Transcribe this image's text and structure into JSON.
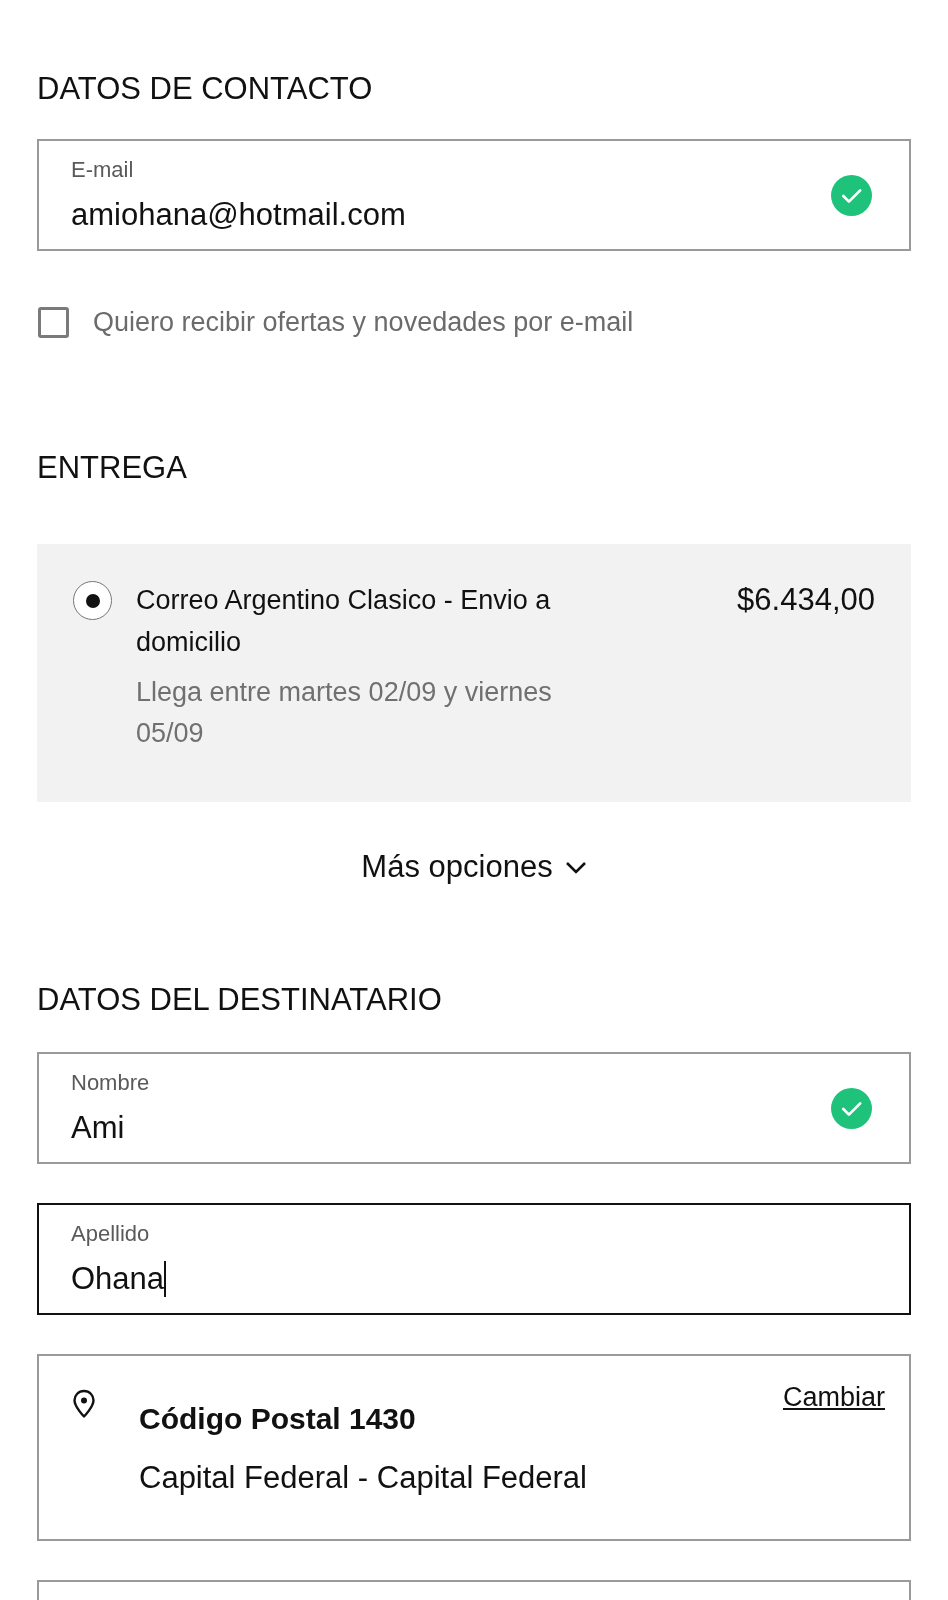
{
  "contact": {
    "heading": "DATOS DE CONTACTO",
    "email": {
      "label": "E-mail",
      "value": "amiohana@hotmail.com",
      "valid": true,
      "focused": false
    },
    "newsletter": {
      "label": "Quiero recibir ofertas y novedades por e-mail",
      "checked": false
    }
  },
  "delivery": {
    "heading": "ENTREGA",
    "options": [
      {
        "title": "Correo Argentino Clasico - Envio a domicilio",
        "estimate": "Llega entre martes 02/09 y viernes 05/09",
        "price": "$6.434,00",
        "selected": true
      }
    ],
    "more_options": "Más opciones"
  },
  "recipient": {
    "heading": "DATOS DEL DESTINATARIO",
    "fields": [
      {
        "label": "Nombre",
        "value": "Ami",
        "valid": true,
        "focused": false
      },
      {
        "label": "Apellido",
        "value": "Ohana",
        "valid": false,
        "focused": true
      }
    ],
    "location": {
      "title": "Código Postal 1430",
      "subtitle": "Capital Federal - Capital Federal",
      "action": "Cambiar"
    }
  }
}
